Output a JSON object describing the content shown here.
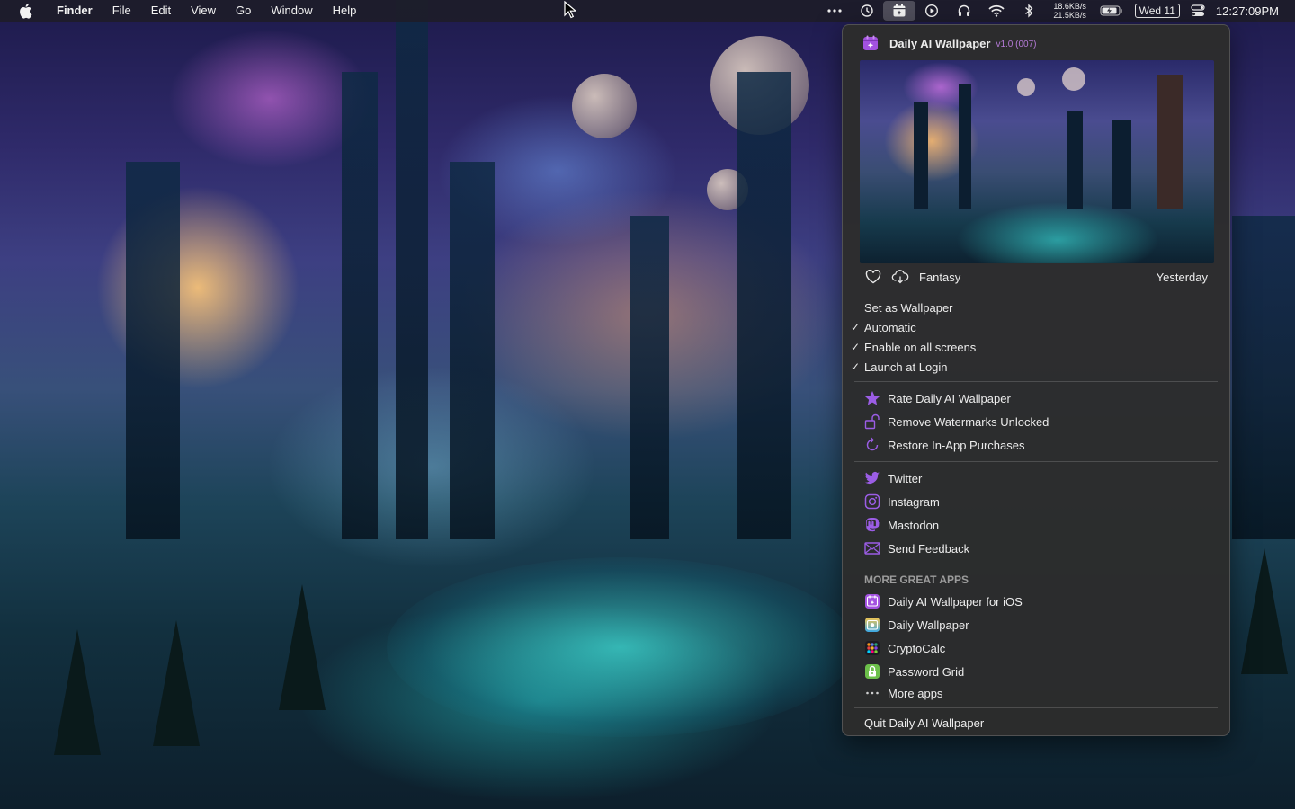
{
  "menubar": {
    "app_name": "Finder",
    "menus": [
      "File",
      "Edit",
      "View",
      "Go",
      "Window",
      "Help"
    ],
    "net_up": "18.6KB/s",
    "net_down": "21.5KB/s",
    "date": "Wed 11",
    "time": "12:27:09PM",
    "status_icons": [
      "more-dots-icon",
      "time-machine-icon",
      "daily-ai-wallpaper-icon",
      "play-icon",
      "headphones-icon",
      "wifi-icon",
      "bluetooth-icon",
      "battery-icon",
      "control-center-icon"
    ]
  },
  "popover": {
    "title": "Daily AI Wallpaper",
    "version": "v1.0 (007)",
    "preview": {
      "category": "Fantasy",
      "date_label": "Yesterday"
    },
    "settings": {
      "set_wallpaper": "Set as Wallpaper",
      "automatic": "Automatic",
      "enable_all_screens": "Enable on all screens",
      "launch_at_login": "Launch at Login"
    },
    "purchases": {
      "rate": "Rate Daily AI Wallpaper",
      "remove_watermarks": "Remove Watermarks Unlocked",
      "restore": "Restore In-App Purchases"
    },
    "social": {
      "twitter": "Twitter",
      "instagram": "Instagram",
      "mastodon": "Mastodon",
      "feedback": "Send Feedback"
    },
    "more_apps": {
      "heading": "MORE GREAT APPS",
      "ios": "Daily AI Wallpaper for iOS",
      "daily_wallpaper": "Daily Wallpaper",
      "cryptocalc": "CryptoCalc",
      "password_grid": "Password Grid",
      "more": "More apps"
    },
    "quit": "Quit Daily AI Wallpaper"
  },
  "colors": {
    "accent_purple": "#9b5de5",
    "version_purple": "#b57bd8",
    "menu_bg": "#2c2c2c"
  }
}
